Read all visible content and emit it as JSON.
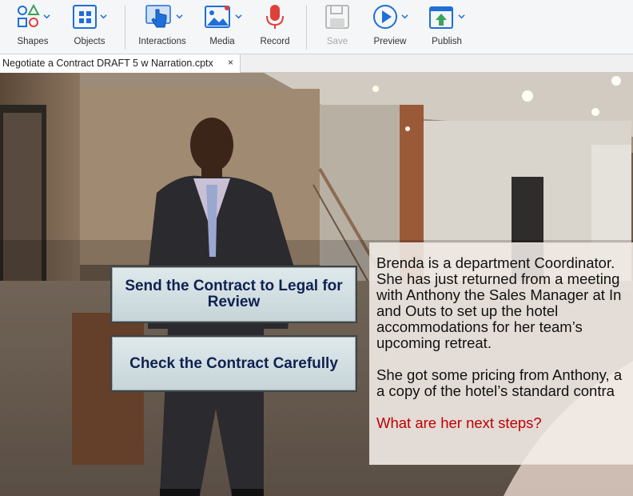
{
  "toolbar": {
    "shapes": "Shapes",
    "objects": "Objects",
    "interactions": "Interactions",
    "media": "Media",
    "record": "Record",
    "save": "Save",
    "preview": "Preview",
    "publish": "Publish"
  },
  "tab": {
    "title": "Negotiate a Contract DRAFT 5 w Narration.cptx",
    "close": "×"
  },
  "slide": {
    "choice1_line1": "Send the Contract to Legal for",
    "choice1_line2": "Review",
    "choice2": "Check the Contract Carefully",
    "paragraph1": [
      "Brenda is a department Coordinator.",
      "She has just returned from a meeting",
      "with Anthony the Sales Manager at In",
      "and Outs to set up the hotel",
      "accommodations for her team’s",
      "upcoming retreat."
    ],
    "paragraph2": [
      "She got some pricing from Anthony, a",
      "a copy of the hotel’s standard contra"
    ],
    "question": "What are her next steps?"
  },
  "colors": {
    "accent_blue": "#1e6fd9",
    "record_red": "#e0403a",
    "button_text": "#0f2250",
    "question_red": "#c00000"
  }
}
